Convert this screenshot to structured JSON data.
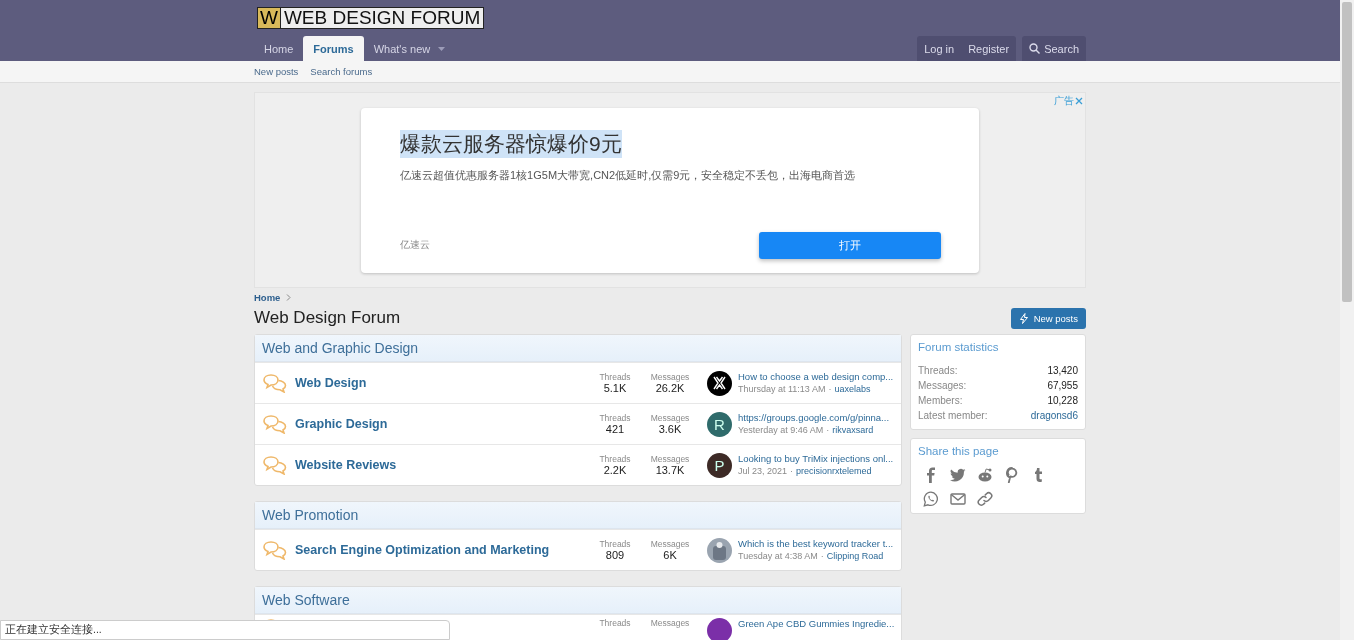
{
  "header": {
    "logo_letter": "W",
    "logo_text": "WEB DESIGN FORUM"
  },
  "nav_tabs": [
    {
      "label": "Home",
      "selected": false,
      "dropdown": false
    },
    {
      "label": "Forums",
      "selected": true,
      "dropdown": false
    },
    {
      "label": "What's new",
      "selected": false,
      "dropdown": true
    }
  ],
  "account_buttons": [
    "Log in",
    "Register"
  ],
  "search_button": "Search",
  "sub_nav": [
    "New posts",
    "Search forums"
  ],
  "ad": {
    "label": "广告",
    "title": "爆款云服务器惊爆价9元",
    "description": "亿速云超值优惠服务器1核1G5M大带宽,CN2低延时,仅需9元，安全稳定不丢包，出海电商首选",
    "advertiser": "亿速云",
    "button": "打开"
  },
  "breadcrumb": [
    "Home"
  ],
  "page_title": "Web Design Forum",
  "new_posts_button": "New posts",
  "categories": [
    {
      "title": "Web and Graphic Design",
      "forums": [
        {
          "name": "Web Design",
          "threads_label": "Threads",
          "threads": "5.1K",
          "messages_label": "Messages",
          "messages": "26.2K",
          "avatar": {
            "kind": "logo",
            "color": "#000000"
          },
          "last_post": "How to choose a web design comp...",
          "time": "Thursday at 11:13 AM",
          "separator": "·",
          "user": "uaxelabs"
        },
        {
          "name": "Graphic Design",
          "threads_label": "Threads",
          "threads": "421",
          "messages_label": "Messages",
          "messages": "3.6K",
          "avatar": {
            "kind": "letter",
            "letter": "R",
            "color": "#2f6b6b"
          },
          "last_post": "https://groups.google.com/g/pinna...",
          "time": "Yesterday at 9:46 AM",
          "separator": "·",
          "user": "rikvaxsard"
        },
        {
          "name": "Website Reviews",
          "threads_label": "Threads",
          "threads": "2.2K",
          "messages_label": "Messages",
          "messages": "13.7K",
          "avatar": {
            "kind": "letter",
            "letter": "P",
            "color": "#3d2a26"
          },
          "last_post": "Looking to buy TriMix injections onl...",
          "time": "Jul 23, 2021",
          "separator": "·",
          "user": "precisionrxtelemed"
        }
      ]
    },
    {
      "title": "Web Promotion",
      "forums": [
        {
          "name": "Search Engine Optimization and Marketing",
          "threads_label": "Threads",
          "threads": "809",
          "messages_label": "Messages",
          "messages": "6K",
          "avatar": {
            "kind": "photo",
            "color": "#9aa4b0"
          },
          "last_post": "Which is the best keyword tracker t...",
          "time": "Tuesday at 4:38 AM",
          "separator": "·",
          "user": "Clipping Road"
        }
      ]
    },
    {
      "title": "Web Software",
      "forums": [
        {
          "threads_label": "Threads",
          "messages_label": "Messages",
          "avatar": {
            "kind": "letter",
            "color": "#7b2fa8"
          },
          "last_post": "Green Ape CBD Gummies Ingredie..."
        }
      ]
    }
  ],
  "forum_statistics": {
    "title": "Forum statistics",
    "rows": [
      {
        "label": "Threads:",
        "value": "13,420",
        "kind": "text"
      },
      {
        "label": "Messages:",
        "value": "67,955",
        "kind": "text"
      },
      {
        "label": "Members:",
        "value": "10,228",
        "kind": "text"
      },
      {
        "label": "Latest member:",
        "value": "dragonsd6",
        "kind": "link"
      }
    ]
  },
  "share": {
    "title": "Share this page"
  },
  "status_bar": "正在建立安全连接..."
}
